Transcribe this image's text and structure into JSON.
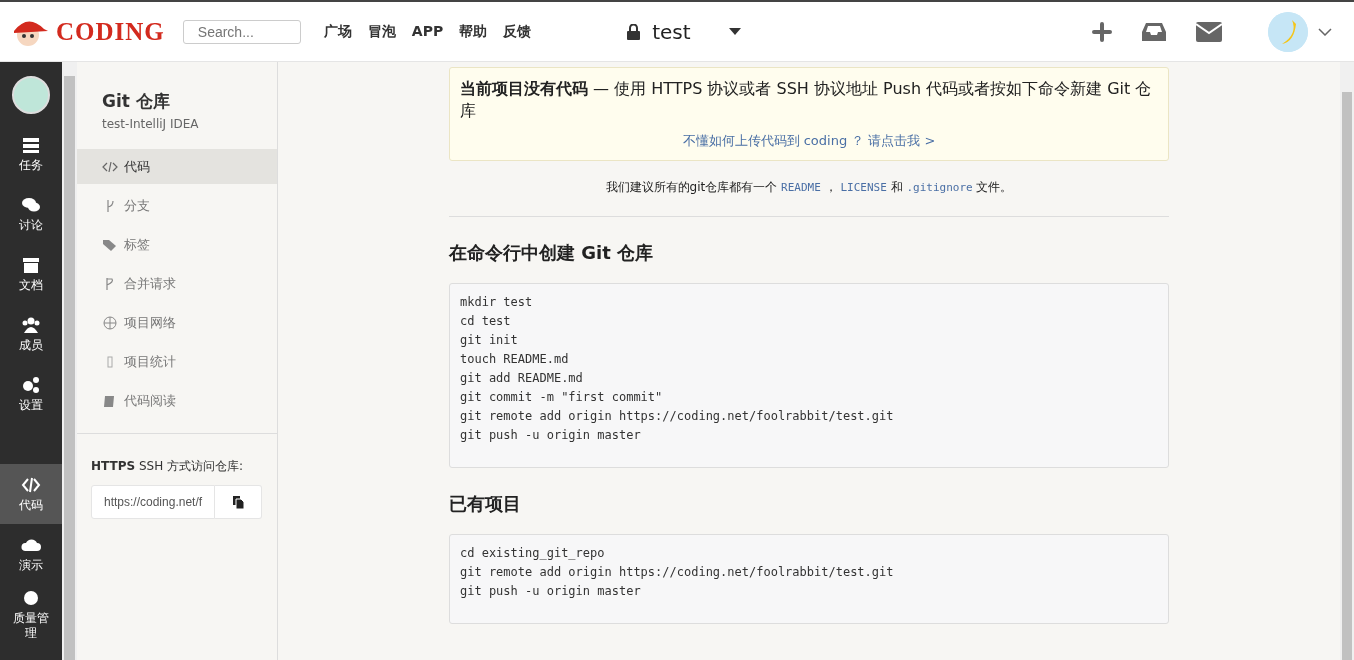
{
  "header": {
    "logo": "CODING",
    "search": {
      "placeholder": "Search..."
    },
    "nav": [
      "广场",
      "冒泡",
      "APP",
      "帮助",
      "反馈"
    ],
    "project": "test"
  },
  "sidebar": {
    "items": [
      {
        "label": "任务",
        "selected": false
      },
      {
        "label": "讨论",
        "selected": false
      },
      {
        "label": "文档",
        "selected": false
      },
      {
        "label": "成员",
        "selected": false
      },
      {
        "label": "设置",
        "selected": false
      },
      {
        "label": "代码",
        "selected": true
      },
      {
        "label": "演示",
        "selected": false
      },
      {
        "label": "质量管理",
        "selected": false
      }
    ]
  },
  "repo_nav": {
    "title": "Git 仓库",
    "subtitle": "test-IntelliJ IDEA",
    "items": [
      {
        "label": "代码",
        "selected": true
      },
      {
        "label": "分支",
        "selected": false
      },
      {
        "label": "标签",
        "selected": false
      },
      {
        "label": "合并请求",
        "selected": false
      },
      {
        "label": "项目网络",
        "selected": false
      },
      {
        "label": "项目统计",
        "selected": false
      },
      {
        "label": "代码阅读",
        "selected": false
      }
    ],
    "access": {
      "label": "**HTTPS** SSH 方式访问仓库:",
      "url": "https://coding.net/f"
    }
  },
  "notice": {
    "text": "**当前项目没有代码** — 使用 HTTPS 协议或者 SSH 协议地址 Push 代码或者按如下命令新建 Git 仓库",
    "link": "不懂如何上传代码到 coding ？ 请点击我 >"
  },
  "suggestion": [
    {
      "kind": "text",
      "text": "我们建议所有的git仓库都有一个 "
    },
    {
      "kind": "code",
      "text": "README"
    },
    {
      "kind": "text",
      "text": " ， "
    },
    {
      "kind": "code",
      "text": "LICENSE"
    },
    {
      "kind": "text",
      "text": " 和 "
    },
    {
      "kind": "code",
      "text": ".gitignore"
    },
    {
      "kind": "text",
      "text": " 文件。"
    }
  ],
  "sections": [
    {
      "title": "在命令行中创建 Git 仓库",
      "lines": [
        "mkdir test",
        "cd test",
        "git init",
        "touch README.md",
        "git add README.md",
        "git commit -m \"first commit\"",
        "git remote add origin https://coding.net/foolrabbit/test.git",
        "git push -u origin master"
      ]
    },
    {
      "title": "已有项目",
      "lines": [
        "cd existing_git_repo",
        "git remote add origin https://coding.net/foolrabbit/test.git",
        "git push -u origin master"
      ]
    }
  ]
}
